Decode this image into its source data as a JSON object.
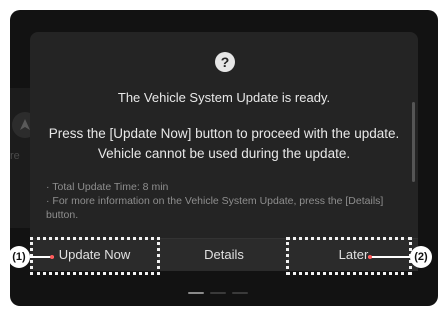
{
  "dialog": {
    "help_icon": "question-icon",
    "title": "The Vehicle System Update is ready.",
    "body": "Press the [Update Now] button to proceed with the update. Vehicle cannot be used during the update.",
    "notes": [
      "· Total Update Time: 8 min",
      "· For more information on the Vehicle System Update, press the [Details] button."
    ],
    "buttons": {
      "update_now": "Update Now",
      "details": "Details",
      "later": "Later"
    }
  },
  "callouts": {
    "one": "(1)",
    "two": "(2)"
  },
  "background": {
    "partial_text": "re"
  },
  "colors": {
    "display_bg": "#121212",
    "dialog_bg": "#242424",
    "text": "#e8e8e8",
    "muted_text": "#8e8e8e",
    "callout_border": "#f2f2f2",
    "callout_tip": "#ff5a5a"
  }
}
